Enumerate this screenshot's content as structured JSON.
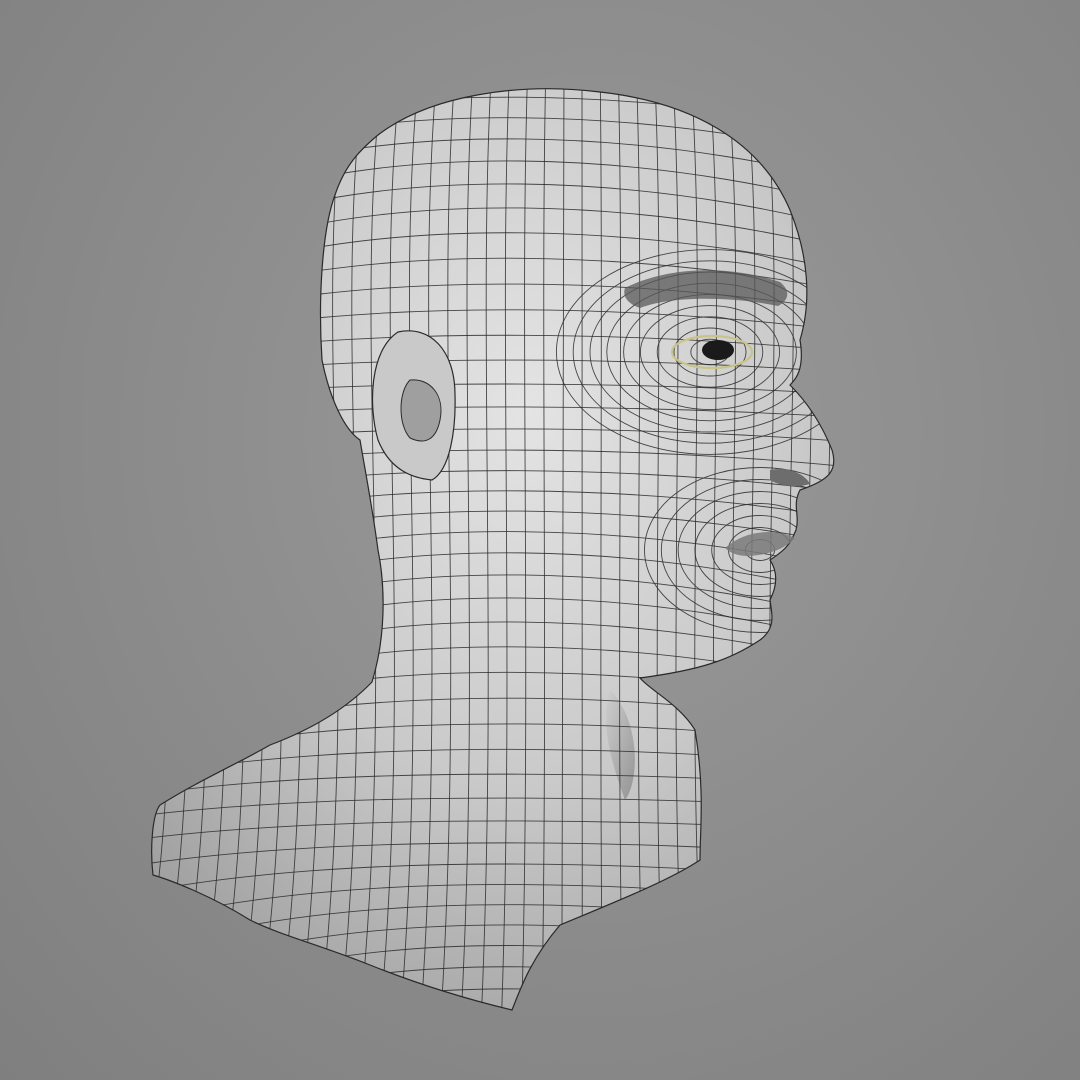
{
  "scene": {
    "subject": "wireframe-head",
    "icon": "head-mesh-icon",
    "colors": {
      "background": "#8a8a8a",
      "surface_light": "#e4e4e4",
      "surface_mid": "#c9c9c9",
      "surface_shadow": "#9f9f9f",
      "wire": "#2a2a2a",
      "eye": "#1a1a1a",
      "eye_highlight": "#c9c38a"
    }
  }
}
